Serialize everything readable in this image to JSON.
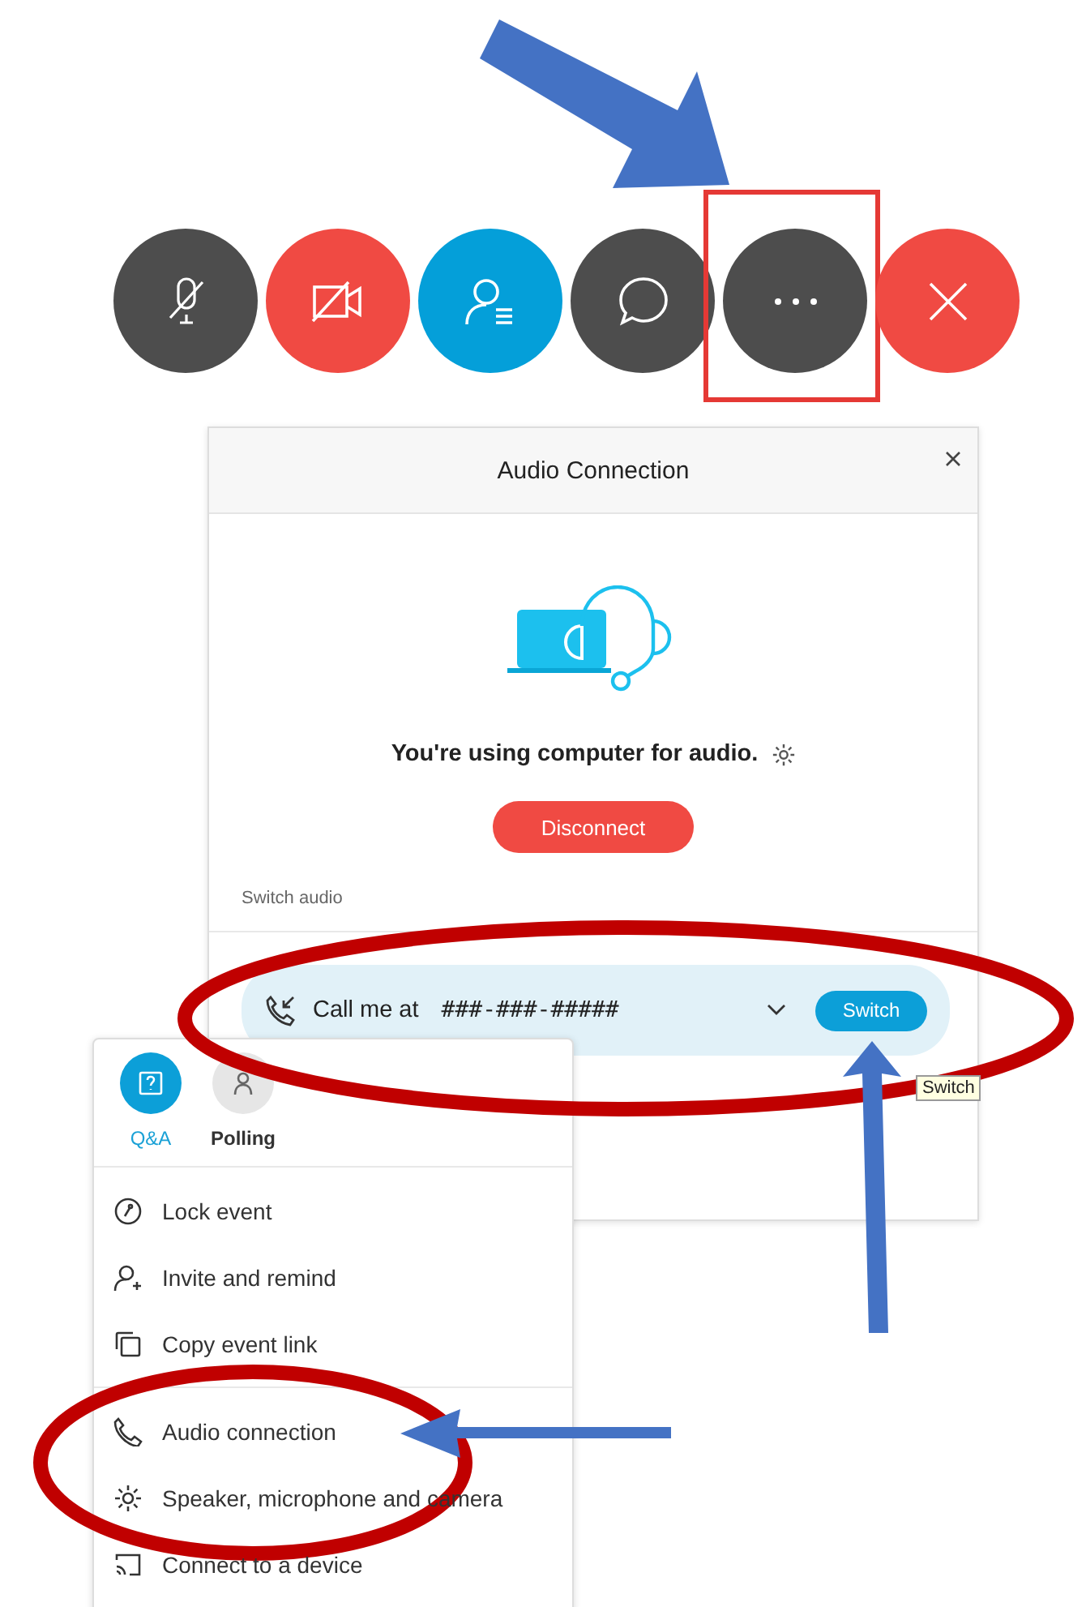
{
  "toolbar": {
    "buttons": [
      {
        "kind": "mic",
        "color": "#4d4d4d",
        "highlighted": false
      },
      {
        "kind": "video",
        "color": "#f04a43",
        "highlighted": false
      },
      {
        "kind": "participants",
        "color": "#049fd9",
        "highlighted": false
      },
      {
        "kind": "chat",
        "color": "#4d4d4d",
        "highlighted": false
      },
      {
        "kind": "more",
        "color": "#4d4d4d",
        "highlighted": true
      },
      {
        "kind": "leave",
        "color": "#f04a43",
        "highlighted": false
      }
    ]
  },
  "dialog": {
    "title": "Audio Connection",
    "status": "You're using computer for audio.",
    "disconnect": "Disconnect",
    "section_label": "Switch audio",
    "option": {
      "label": "Call me at",
      "value": "###-###-#####",
      "switch_button": "Switch"
    },
    "tooltip": "Switch"
  },
  "menu": {
    "tabs": [
      {
        "label": "Q&A",
        "kind": "qa",
        "selected": true
      },
      {
        "label": "Polling",
        "kind": "polling",
        "selected": false
      }
    ],
    "groups": [
      [
        {
          "kind": "lock",
          "label": "Lock event"
        },
        {
          "kind": "invite",
          "label": "Invite and remind"
        },
        {
          "kind": "copy",
          "label": "Copy event link"
        }
      ],
      [
        {
          "kind": "phone",
          "label": "Audio connection"
        },
        {
          "kind": "gear",
          "label": "Speaker, microphone and camera"
        },
        {
          "kind": "cast",
          "label": "Connect to a device"
        }
      ]
    ]
  }
}
